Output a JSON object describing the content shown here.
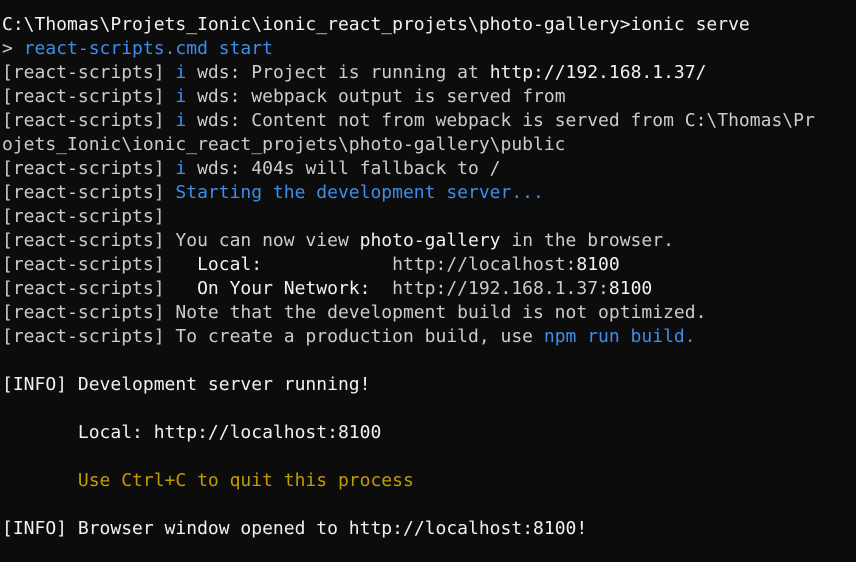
{
  "terminal": {
    "prompt": {
      "path": "C:\\Thomas\\Projets_Ionic\\ionic_react_projets\\photo-gallery>",
      "command": "ionic serve"
    },
    "subcommand": {
      "symbol": "> ",
      "text": "react-scripts.cmd start"
    },
    "tag": "[react-scripts] ",
    "info_glyph": "i",
    "wds_tag": " \u0001wds\u0001: ",
    "wds_lines": {
      "running_prefix": "Project is running at ",
      "running_url": "http://192.168.1.37/",
      "webpack_output": "webpack output is served from",
      "content_prefix": "Content not from webpack is served from ",
      "content_path_part1": "C:\\Thomas\\Pr",
      "content_path_part2": "ojets_Ionic\\ionic_react_projets\\photo-gallery\\public",
      "fallback": "404s will fallback to /"
    },
    "starting": "Starting the development server...",
    "view": {
      "prefix": "You can now view ",
      "app": "photo-gallery",
      "suffix": " in the browser."
    },
    "local": {
      "label": "  Local:            ",
      "url_base": "http://localhost:",
      "port": "8100"
    },
    "network": {
      "label": "  On Your Network:  ",
      "url_base": "http://192.168.1.37:",
      "port": "8100"
    },
    "note": "Note that the development build is not optimized.",
    "production": {
      "prefix": "To create a production build, use ",
      "command": "npm run build",
      "suffix": "."
    },
    "info_tag": "[INFO] ",
    "server_running": "Development server running!",
    "info_local": {
      "label": "Local: ",
      "url": "http://localhost:8100"
    },
    "quit_hint": "Use Ctrl+C to quit this process",
    "browser": {
      "prefix": "Browser window opened to ",
      "url": "http://localhost:8100",
      "suffix": "!"
    },
    "indent": "       "
  },
  "colors": {
    "background": "#0c0c0c",
    "text": "#cccccc",
    "bright": "#f2f2f2",
    "accent_blue": "#3b8eea",
    "warning_yellow": "#c19c00"
  }
}
